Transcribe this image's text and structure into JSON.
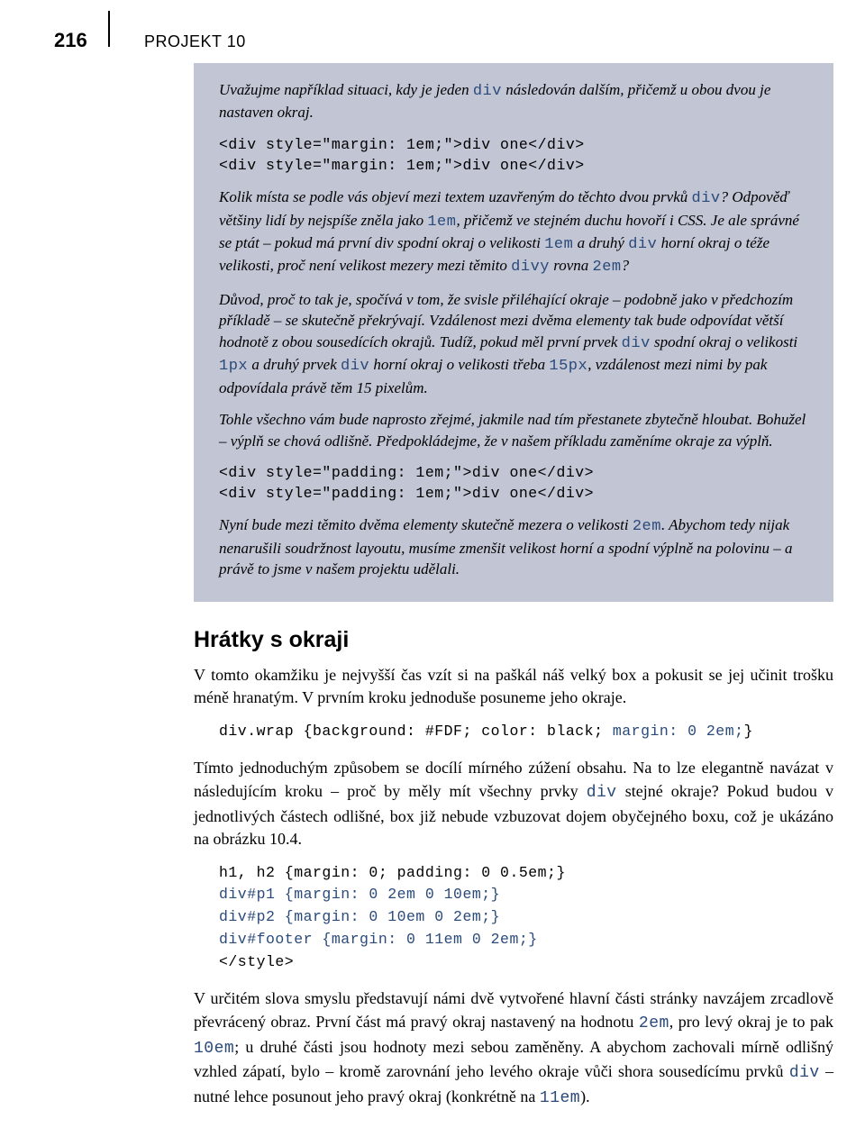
{
  "header": {
    "pageNumber": "216",
    "chapter": "PROJEKT 10"
  },
  "callout": {
    "p1_a": "Uvažujme například situaci, kdy je jeden ",
    "p1_code1": "div",
    "p1_b": " následován dalším, přičemž u obou dvou je nastaven okraj.",
    "code1": "<div style=\"margin: 1em;\">div one</div>\n<div style=\"margin: 1em;\">div one</div>",
    "p2_a": "Kolik místa se podle vás objeví mezi textem uzavřeným do těchto dvou prvků ",
    "p2_code1": "div",
    "p2_b": "? Odpověď většiny lidí by nejspíše zněla jako ",
    "p2_code2": "1em",
    "p2_c": ", přičemž ve stejném duchu hovoří i CSS. Je ale správné se ptát – pokud má první div spodní okraj o velikosti ",
    "p2_code3": "1em",
    "p2_d": " a druhý ",
    "p2_code4": "div",
    "p2_e": " horní okraj o téže velikosti, proč není velikost mezery mezi těmito ",
    "p2_code5": "divy",
    "p2_f": " rovna ",
    "p2_code6": "2em",
    "p2_g": "?",
    "p3_a": "Důvod, proč to tak je, spočívá v tom, že svisle přiléhající okraje – podobně jako v předchozím příkladě – se skutečně překrývají. Vzdálenost mezi dvěma elementy tak bude odpovídat větší hodnotě z obou sousedících okrajů. Tudíž, pokud měl první prvek ",
    "p3_code1": "div",
    "p3_b": " spodní okraj o velikosti ",
    "p3_code2": "1px",
    "p3_c": " a druhý prvek ",
    "p3_code3": "div",
    "p3_d": " horní okraj o velikosti třeba ",
    "p3_code4": "15px",
    "p3_e": ", vzdálenost mezi nimi by pak odpovídala právě těm 15 pixelům.",
    "p4": "Tohle všechno vám bude naprosto zřejmé, jakmile nad tím přestanete zbytečně hloubat. Bohužel – výplň se chová odlišně. Předpokládejme, že v našem příkladu zaměníme okraje za výplň.",
    "code2": "<div style=\"padding: 1em;\">div one</div>\n<div style=\"padding: 1em;\">div one</div>",
    "p5_a": "Nyní bude mezi těmito dvěma elementy skutečně mezera o velikosti ",
    "p5_code1": "2em",
    "p5_b": ". Abychom tedy nijak nenarušili soudržnost layoutu, musíme zmenšit velikost horní a spodní výplně na polovinu – a právě to jsme v našem projektu udělali."
  },
  "section": {
    "heading": "Hrátky s okraji",
    "p1": "V tomto okamžiku je nejvyšší čas vzít si na paškál náš velký box a pokusit se jej učinit trošku méně hranatým. V prvním kroku jednoduše posuneme jeho okraje.",
    "code1_a": "div.wrap {background: #FDF; color: black; ",
    "code1_kw": "margin: 0 2em;",
    "code1_b": "}",
    "p2_a": "Tímto jednoduchým způsobem se docílí mírného zúžení obsahu. Na to lze elegantně navázat v následujícím kroku – proč by měly mít všechny prvky ",
    "p2_code1": "div",
    "p2_b": " stejné okraje? Pokud budou v jednotlivých částech odlišné, box již nebude vzbuzovat dojem obyčejného boxu, což je ukázáno na obrázku 10.4.",
    "code2_l1": "h1, h2 {margin: 0; padding: 0 0.5em;}",
    "code2_l2": "div#p1 {margin: 0 2em 0 10em;}",
    "code2_l3": "div#p2 {margin: 0 10em 0 2em;}",
    "code2_l4": "div#footer {margin: 0 11em 0 2em;}",
    "code2_l5": "</style>",
    "p3_a": "V určitém slova smyslu představují námi dvě vytvořené hlavní části stránky navzájem zrcadlově převrácený obraz. První část má pravý okraj nastavený na hodnotu ",
    "p3_code1": "2em",
    "p3_b": ", pro levý okraj je to pak ",
    "p3_code2": "10em",
    "p3_c": "; u druhé části jsou hodnoty mezi sebou zaměněny. A abychom zachovali mírně odlišný vzhled zápatí, bylo – kromě zarovnání jeho levého okraje vůči shora sousedícímu prvků ",
    "p3_code3": "div",
    "p3_d": " –  nutné lehce posunout jeho pravý okraj (konkrétně na ",
    "p3_code4": "11em",
    "p3_e": ")."
  }
}
